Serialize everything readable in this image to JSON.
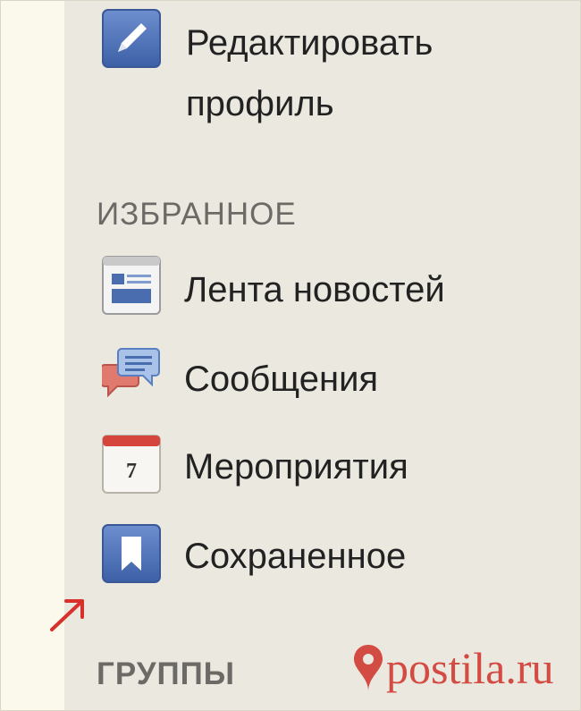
{
  "menu": {
    "edit_profile_line1": "Редактировать",
    "edit_profile_line2": "профиль",
    "favorites_header": "ИЗБРАННОЕ",
    "items": [
      {
        "label": "Лента новостей",
        "icon": "news-feed-icon"
      },
      {
        "label": "Сообщения",
        "icon": "messages-icon"
      },
      {
        "label": "Мероприятия",
        "icon": "calendar-icon",
        "icon_text": "7"
      },
      {
        "label": "Сохраненное",
        "icon": "bookmark-icon"
      }
    ],
    "groups_header": "ГРУППЫ"
  },
  "watermark": "postila.ru",
  "colors": {
    "accent_blue": "#4a6db0",
    "arrow_red": "#d8302b",
    "watermark_red": "#d34c43"
  }
}
